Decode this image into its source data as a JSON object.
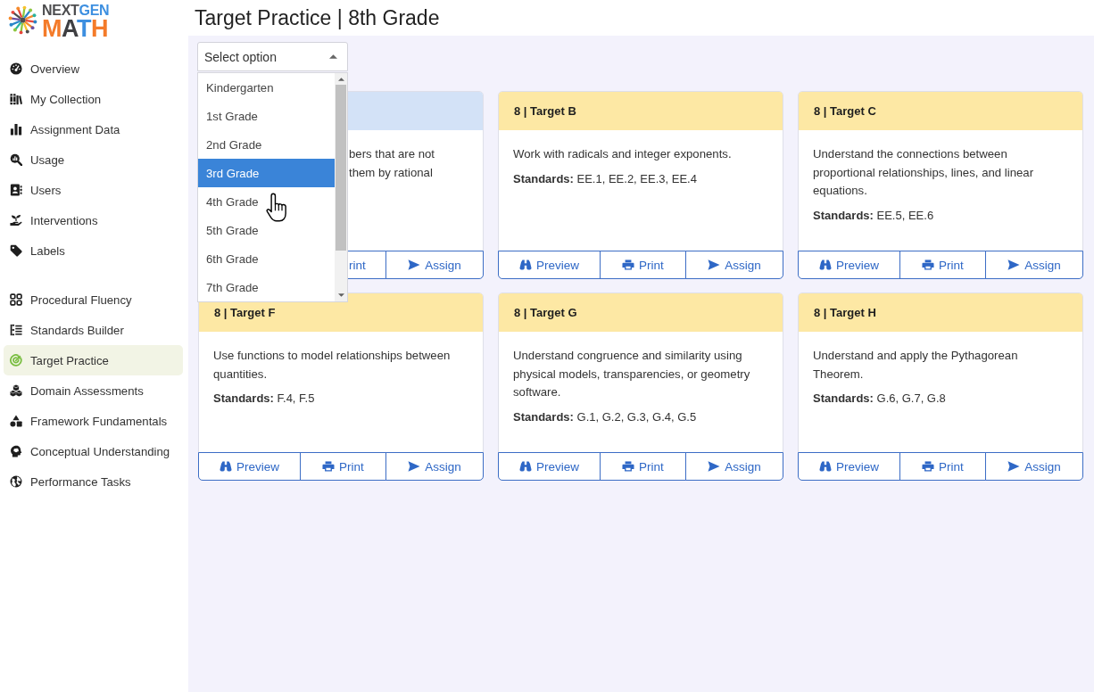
{
  "logo": {
    "top": "NEXTGEN",
    "bottom": "MATH"
  },
  "sidebar": {
    "sections": [
      {
        "items": [
          {
            "label": "Overview",
            "selected": false
          },
          {
            "label": "My Collection",
            "selected": false
          },
          {
            "label": "Assignment Data",
            "selected": false
          },
          {
            "label": "Usage",
            "selected": false
          },
          {
            "label": "Users",
            "selected": false
          },
          {
            "label": "Interventions",
            "selected": false
          },
          {
            "label": "Labels",
            "selected": false
          }
        ]
      },
      {
        "items": [
          {
            "label": "Procedural Fluency",
            "selected": false
          },
          {
            "label": "Standards Builder",
            "selected": false
          },
          {
            "label": "Target Practice",
            "selected": true
          },
          {
            "label": "Domain Assessments",
            "selected": false
          },
          {
            "label": "Framework Fundamentals",
            "selected": false
          },
          {
            "label": "Conceptual Understanding",
            "selected": false
          },
          {
            "label": "Performance Tasks",
            "selected": false
          }
        ]
      }
    ]
  },
  "page": {
    "title": "Target Practice | 8th Grade"
  },
  "grade_select": {
    "placeholder": "Select option",
    "expanded": true,
    "options": [
      {
        "label": "Kindergarten",
        "selected": false
      },
      {
        "label": "1st Grade",
        "selected": false
      },
      {
        "label": "2nd Grade",
        "selected": false
      },
      {
        "label": "3rd Grade",
        "selected": true
      },
      {
        "label": "4th Grade",
        "selected": false
      },
      {
        "label": "5th Grade",
        "selected": false
      },
      {
        "label": "6th Grade",
        "selected": false
      },
      {
        "label": "7th Grade",
        "selected": false
      }
    ]
  },
  "cards": [
    {
      "color": "#d3e2f7",
      "covered": true,
      "fragments": [
        "bers that are not",
        "them by rational"
      ],
      "buttons": [
        {
          "kind": "print",
          "label": "rint",
          "cut": true
        },
        {
          "kind": "assign",
          "label": "Assign",
          "cut": false
        }
      ]
    },
    {
      "color": "#fde8a4",
      "covered": false,
      "title": "8 | Target B",
      "description": "Work with radicals and integer exponents.",
      "standards": "**Standards:** EE.1, EE.2, EE.3, EE.4",
      "buttons": [
        {
          "kind": "preview",
          "label": "Preview",
          "cut": false
        },
        {
          "kind": "print",
          "label": "Print",
          "cut": false
        },
        {
          "kind": "assign",
          "label": "Assign",
          "cut": false
        }
      ]
    },
    {
      "color": "#fde8a4",
      "covered": false,
      "title": "8 | Target C",
      "description": "Understand the connections between proportional relationships, lines, and linear equations.",
      "standards": "**Standards:** EE.5, EE.6",
      "buttons": [
        {
          "kind": "preview",
          "label": "Preview",
          "cut": false
        },
        {
          "kind": "print",
          "label": "Print",
          "cut": false
        },
        {
          "kind": "assign",
          "label": "Assign",
          "cut": false
        }
      ]
    },
    {
      "color": "#fde8a4",
      "covered": false,
      "title": "8 | Target F",
      "description": "Use functions to model relationships between quantities.",
      "standards": "**Standards:** F.4, F.5",
      "buttons": [
        {
          "kind": "preview",
          "label": "Preview",
          "cut": false
        },
        {
          "kind": "print",
          "label": "Print",
          "cut": false
        },
        {
          "kind": "assign",
          "label": "Assign",
          "cut": false
        }
      ]
    },
    {
      "color": "#fde8a4",
      "covered": false,
      "title": "8 | Target G",
      "description": "Understand congruence and similarity using physical models, transparencies, or geometry software.",
      "standards": "**Standards:** G.1, G.2, G.3, G.4, G.5",
      "buttons": [
        {
          "kind": "preview",
          "label": "Preview",
          "cut": false
        },
        {
          "kind": "print",
          "label": "Print",
          "cut": false
        },
        {
          "kind": "assign",
          "label": "Assign",
          "cut": false
        }
      ]
    },
    {
      "color": "#fde8a4",
      "covered": false,
      "title": "8 | Target H",
      "description": "Understand and apply the Pythagorean Theorem.",
      "standards": "**Standards:** G.6, G.7, G.8",
      "buttons": [
        {
          "kind": "preview",
          "label": "Preview",
          "cut": false
        },
        {
          "kind": "print",
          "label": "Print",
          "cut": false
        },
        {
          "kind": "assign",
          "label": "Assign",
          "cut": false
        }
      ]
    }
  ]
}
